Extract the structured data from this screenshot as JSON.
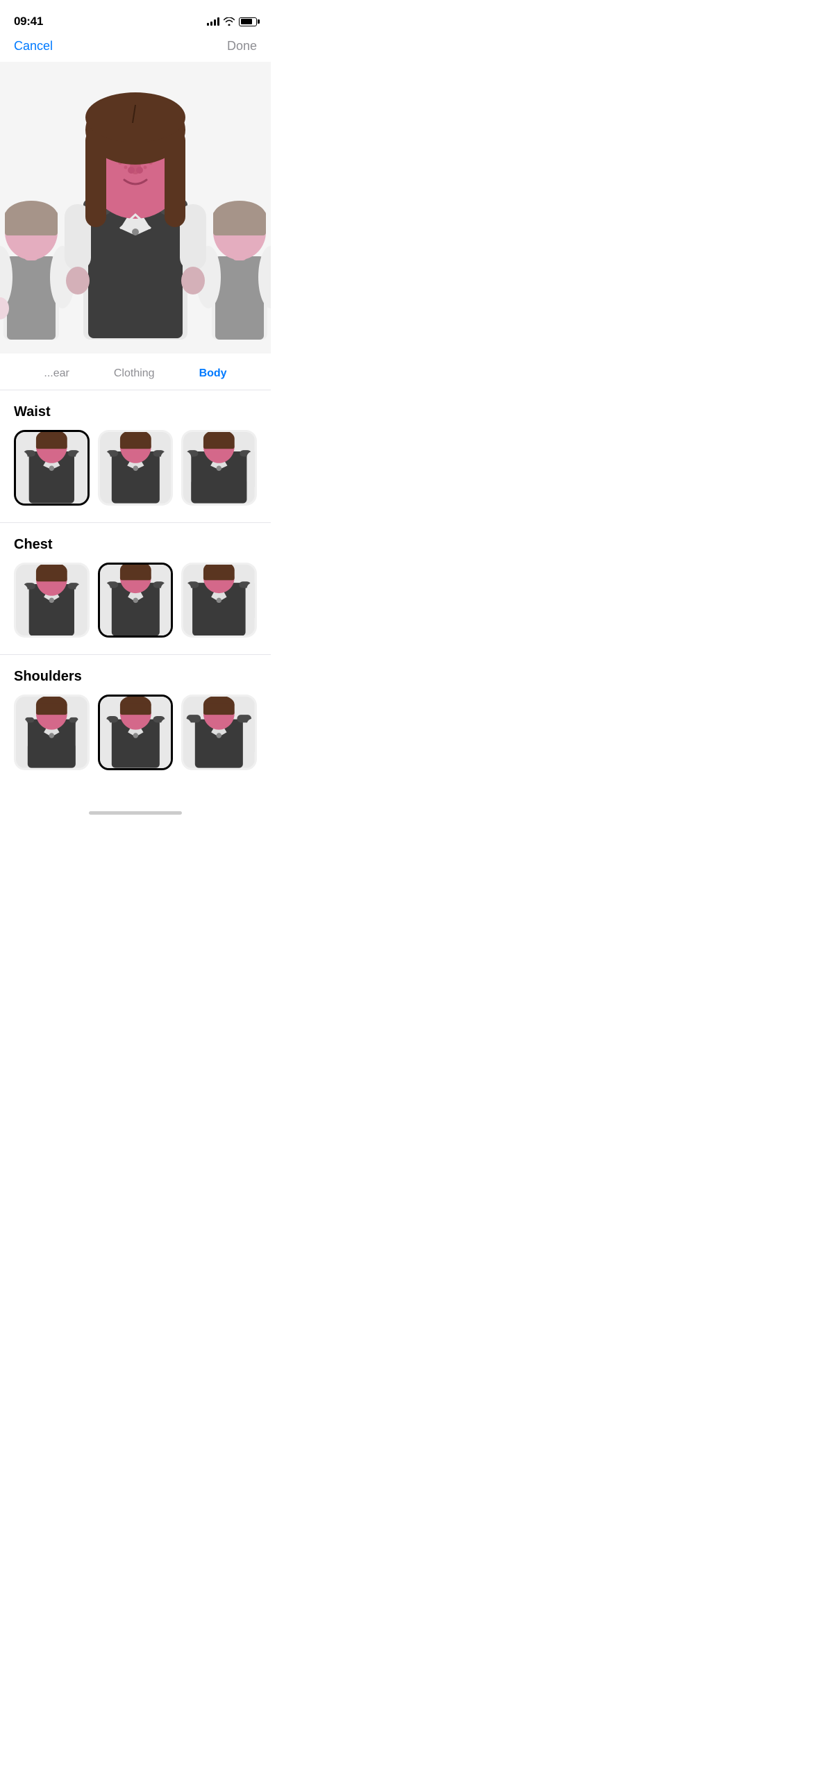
{
  "statusBar": {
    "time": "09:41",
    "signalBars": 4,
    "batteryPercent": 80
  },
  "nav": {
    "cancel": "Cancel",
    "done": "Done"
  },
  "tabs": [
    {
      "id": "ear",
      "label": "ear",
      "active": false
    },
    {
      "id": "clothing",
      "label": "Clothing",
      "active": false
    },
    {
      "id": "body",
      "label": "Body",
      "active": true
    }
  ],
  "sections": [
    {
      "id": "waist",
      "title": "Waist",
      "options": [
        {
          "id": "w1",
          "selected": true
        },
        {
          "id": "w2",
          "selected": false
        },
        {
          "id": "w3",
          "selected": false
        }
      ]
    },
    {
      "id": "chest",
      "title": "Chest",
      "options": [
        {
          "id": "c1",
          "selected": false
        },
        {
          "id": "c2",
          "selected": true
        },
        {
          "id": "c3",
          "selected": false
        }
      ]
    },
    {
      "id": "shoulders",
      "title": "Shoulders",
      "options": [
        {
          "id": "s1",
          "selected": false
        },
        {
          "id": "s2",
          "selected": true
        },
        {
          "id": "s3",
          "selected": false
        }
      ]
    }
  ],
  "colors": {
    "accent": "#007AFF",
    "primary": "#000000",
    "secondary": "#8e8e93",
    "background": "#f5f5f5",
    "card": "#f0f0f0",
    "border": "#e5e5ea",
    "avatarSkin": "#e8a8b8",
    "avatarFace": "#d4688a",
    "avatarHair": "#5a3520",
    "avatarVest": "#3a3a3a",
    "avatarShirt": "#e8e8e8"
  }
}
